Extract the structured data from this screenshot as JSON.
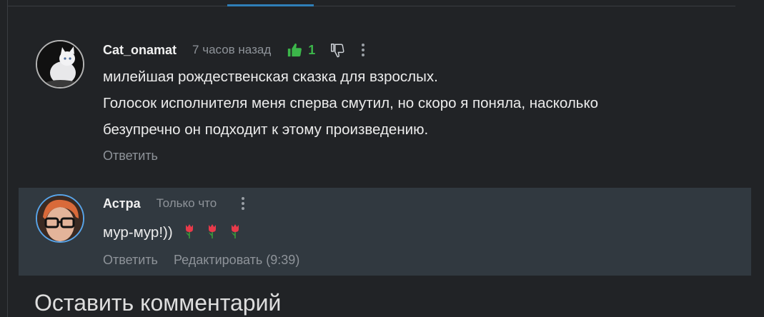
{
  "comments": [
    {
      "author": "Cat_onamat",
      "time": "7 часов назад",
      "likes": "1",
      "lines": [
        "милейшая рождественская сказка для взрослых.",
        "Голосок исполнителя меня сперва смутил, но скоро я поняла, насколько",
        "безупречно он подходит к этому произведению."
      ],
      "reply_label": "Ответить",
      "avatar_icon": "white-cat-photo"
    },
    {
      "author": "Астра",
      "time": "Только что",
      "text": "мур-мур!))",
      "emoji": [
        "tulip-emoji",
        "tulip-emoji",
        "tulip-emoji"
      ],
      "reply_label": "Ответить",
      "edit_label": "Редактировать (9:39)",
      "avatar_icon": "person-glasses-photo",
      "highlight_color": "#313940",
      "avatar_ring_color": "#58a4e8"
    }
  ],
  "leave_comment_title": "Оставить комментарий",
  "colors": {
    "background": "#212326",
    "accent": "#2f7fb8",
    "like_green": "#3cb64a",
    "muted": "#8e9399"
  }
}
